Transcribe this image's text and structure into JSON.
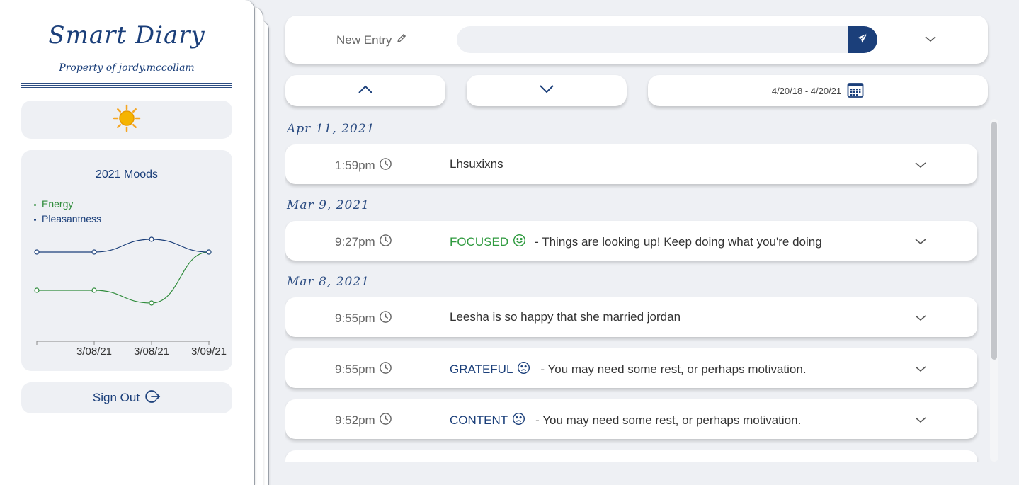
{
  "sidebar": {
    "title": "Smart Diary",
    "owner": "Property of jordy.mccollam",
    "weather_icon": "sun-icon",
    "mood_chart_title": "2021 Moods",
    "sign_out_label": "Sign Out"
  },
  "chart_data": {
    "type": "line",
    "title": "2021 Moods",
    "categories": [
      "",
      "3/08/21",
      "3/08/21",
      "3/09/21"
    ],
    "series": [
      {
        "name": "Energy",
        "color": "#2e8b3a",
        "values": [
          4,
          4,
          3,
          7
        ]
      },
      {
        "name": "Pleasantness",
        "color": "#1b3f7a",
        "values": [
          7,
          7,
          8,
          7
        ]
      }
    ],
    "ylim": [
      0,
      10
    ],
    "legend": "top-left",
    "grid": false
  },
  "entry_bar": {
    "label": "New Entry",
    "input_value": "",
    "input_placeholder": ""
  },
  "date_range": "4/20/18 - 4/20/21",
  "groups": [
    {
      "date": "Apr 11, 2021",
      "entries": [
        {
          "time": "1:59pm",
          "mood": "",
          "text": "Lhsuxixns"
        }
      ]
    },
    {
      "date": "Mar 9, 2021",
      "entries": [
        {
          "time": "9:27pm",
          "mood": "FOCUSED",
          "text": "- Things are looking up! Keep doing what you're doing"
        }
      ]
    },
    {
      "date": "Mar 8, 2021",
      "entries": [
        {
          "time": "9:55pm",
          "mood": "",
          "text": "Leesha is so happy that she married jordan"
        },
        {
          "time": "9:55pm",
          "mood": "GRATEFUL",
          "text": "- You may need some rest, or perhaps motivation."
        },
        {
          "time": "9:52pm",
          "mood": "CONTENT",
          "text": "- You may need some rest, or perhaps motivation."
        }
      ]
    }
  ],
  "colors": {
    "accent": "#1b3f7a",
    "energy": "#2e8b3a",
    "focused": "#2e9a3e",
    "background": "#eef0f4"
  }
}
